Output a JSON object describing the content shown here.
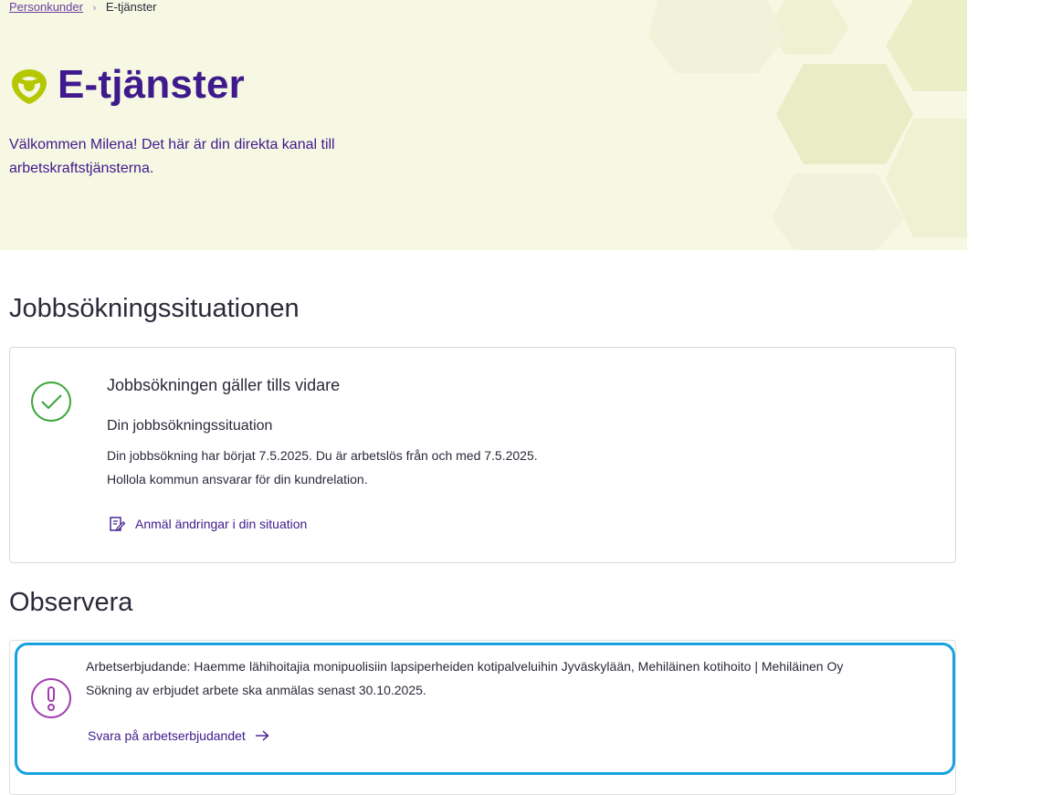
{
  "breadcrumb": {
    "home": "Personkunder",
    "current": "E-tjänster"
  },
  "hero": {
    "title": "E-tjänster",
    "intro": "Välkommen Milena! Det här är din direkta kanal till arbetskraftstjänsterna."
  },
  "job_section": {
    "heading": "Jobbsökningssituationen",
    "card_title": "Jobbsökningen gäller tills vidare",
    "subheading": "Din jobbsökningssituation",
    "text1": "Din jobbsökning har börjat 7.5.2025. Du är arbetslös från och med 7.5.2025.",
    "text2": "Hollola kommun ansvarar för din kundrelation.",
    "link": "Anmäl ändringar i din situation",
    "status_icon": "check-circle-icon",
    "link_icon": "edit-document-icon"
  },
  "notice_section": {
    "heading": "Observera",
    "title": "Arbetserbjudande: Haemme lähihoitajia monipuolisiin lapsiperheiden kotipalveluihin Jyväskylään, Mehiläinen kotihoito | Mehiläinen Oy",
    "text": "Sökning av erbjudet arbete ska anmälas senast 30.10.2025.",
    "link": "Svara på arbetserbjudandet",
    "alert_icon": "exclamation-circle-icon",
    "link_icon": "arrow-right-icon"
  },
  "colors": {
    "brand_purple": "#3e1a8c",
    "hero_background": "#f6f8e3",
    "logo_green": "#b5c700",
    "success_green": "#3aa53a",
    "alert_purple": "#a23bb0",
    "highlight_blue": "#17a2df"
  }
}
